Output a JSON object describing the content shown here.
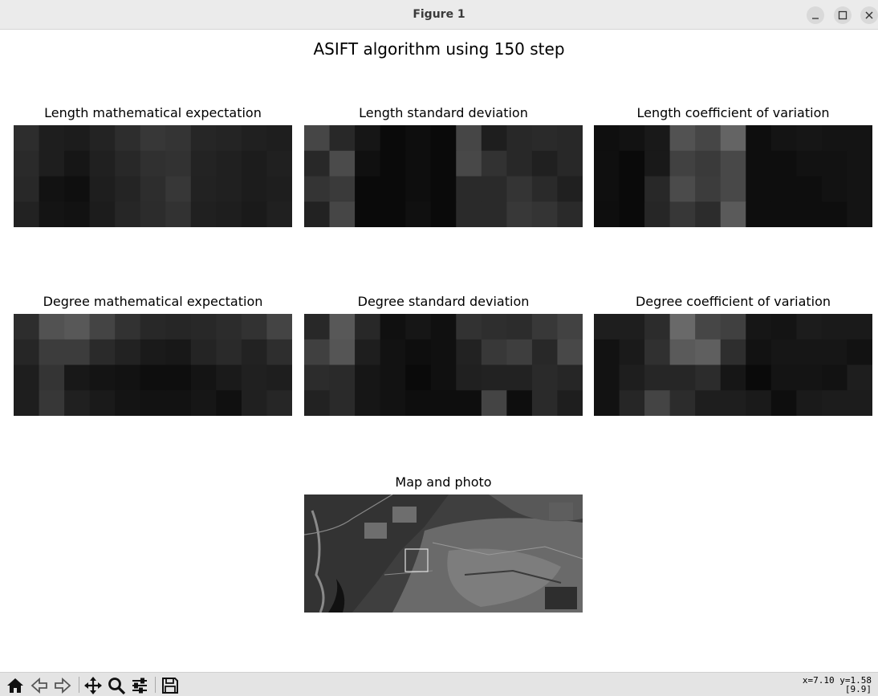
{
  "window": {
    "title": "Figure 1"
  },
  "figure": {
    "suptitle": "ASIFT algorithm using 150 step",
    "panels": [
      {
        "title": "Length mathematical expectation",
        "cells": [
          [
            45,
            30,
            28,
            35,
            45,
            55,
            52,
            38,
            36,
            32,
            30
          ],
          [
            42,
            30,
            22,
            32,
            40,
            48,
            50,
            35,
            32,
            28,
            32
          ],
          [
            40,
            18,
            15,
            30,
            36,
            45,
            55,
            34,
            32,
            28,
            30
          ],
          [
            34,
            20,
            18,
            28,
            38,
            44,
            50,
            32,
            30,
            26,
            32
          ]
        ]
      },
      {
        "title": "Length standard deviation",
        "cells": [
          [
            70,
            40,
            22,
            10,
            14,
            10,
            70,
            30,
            40,
            42,
            40
          ],
          [
            40,
            75,
            16,
            10,
            14,
            10,
            72,
            50,
            40,
            32,
            40
          ],
          [
            52,
            58,
            10,
            10,
            14,
            10,
            42,
            42,
            52,
            42,
            32
          ],
          [
            34,
            70,
            10,
            10,
            16,
            10,
            42,
            42,
            56,
            52,
            42
          ]
        ]
      },
      {
        "title": "Length coefficient of variation",
        "cells": [
          [
            15,
            18,
            25,
            82,
            70,
            100,
            14,
            20,
            22,
            20,
            20
          ],
          [
            15,
            10,
            25,
            65,
            58,
            72,
            14,
            14,
            18,
            18,
            20
          ],
          [
            15,
            10,
            40,
            75,
            60,
            72,
            14,
            14,
            14,
            18,
            20
          ],
          [
            14,
            10,
            38,
            55,
            44,
            90,
            14,
            14,
            14,
            14,
            20
          ]
        ]
      },
      {
        "title": "Degree mathematical expectation",
        "cells": [
          [
            45,
            82,
            88,
            68,
            50,
            40,
            38,
            40,
            44,
            50,
            68
          ],
          [
            38,
            60,
            60,
            42,
            34,
            26,
            24,
            36,
            42,
            34,
            46
          ],
          [
            30,
            52,
            24,
            20,
            18,
            14,
            14,
            20,
            26,
            32,
            30
          ],
          [
            30,
            55,
            32,
            26,
            20,
            18,
            18,
            22,
            16,
            32,
            38
          ]
        ]
      },
      {
        "title": "Degree standard deviation",
        "cells": [
          [
            40,
            88,
            40,
            16,
            22,
            16,
            50,
            46,
            44,
            56,
            66
          ],
          [
            64,
            85,
            30,
            18,
            14,
            16,
            34,
            56,
            62,
            40,
            72
          ],
          [
            44,
            42,
            22,
            18,
            10,
            16,
            32,
            34,
            34,
            42,
            38
          ],
          [
            34,
            42,
            22,
            18,
            14,
            14,
            14,
            68,
            14,
            42,
            30
          ]
        ]
      },
      {
        "title": "Degree coefficient of variation",
        "cells": [
          [
            30,
            30,
            44,
            105,
            70,
            64,
            22,
            20,
            28,
            26,
            26
          ],
          [
            18,
            26,
            48,
            90,
            95,
            46,
            18,
            22,
            22,
            22,
            18
          ],
          [
            18,
            30,
            38,
            38,
            44,
            22,
            10,
            20,
            20,
            18,
            30
          ],
          [
            18,
            38,
            68,
            44,
            30,
            30,
            26,
            14,
            26,
            28,
            28
          ]
        ]
      }
    ],
    "photo": {
      "title": "Map and photo"
    }
  },
  "toolbar": {
    "coords_line1": "x=7.10 y=1.58",
    "coords_line2": "[9.9]"
  }
}
